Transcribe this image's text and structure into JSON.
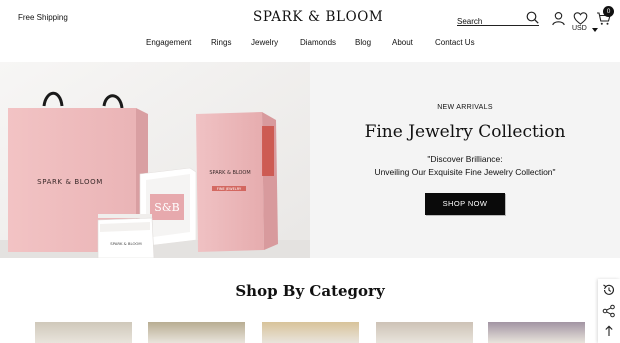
{
  "header": {
    "promo": "Free Shipping",
    "brand": "SPARK & BLOOM",
    "search_placeholder": "Search",
    "cart_count": "0",
    "currency": "USD"
  },
  "nav": {
    "items": [
      {
        "label": "Engagement"
      },
      {
        "label": "Rings"
      },
      {
        "label": "Jewelry"
      },
      {
        "label": "Diamonds"
      },
      {
        "label": "Blog"
      },
      {
        "label": "About"
      },
      {
        "label": "Contact Us"
      }
    ]
  },
  "hero": {
    "eyebrow": "NEW ARRIVALS",
    "title": "Fine Jewelry Collection",
    "subtitle_line1": "\"Discover Brilliance:",
    "subtitle_line2": "Unveiling Our Exquisite Fine Jewelry Collection\"",
    "button": "SHOP NOW",
    "image": {
      "bag_brand": "SPARK & BLOOM",
      "box_monogram": "S&B",
      "box_brand": "SPARK & BLOOM",
      "box_tag": "FINE JEWELRY"
    }
  },
  "categories": {
    "title": "Shop By Category",
    "tile_colors": [
      "#cfc8ba",
      "#b8ad92",
      "#d8c39a",
      "#cdc2b6",
      "#a294a3"
    ]
  },
  "icons": {
    "search": "search-icon",
    "user": "user-icon",
    "wishlist": "heart-icon",
    "cart": "cart-icon",
    "recent": "history-icon",
    "share": "share-icon",
    "top": "arrow-up-icon"
  }
}
